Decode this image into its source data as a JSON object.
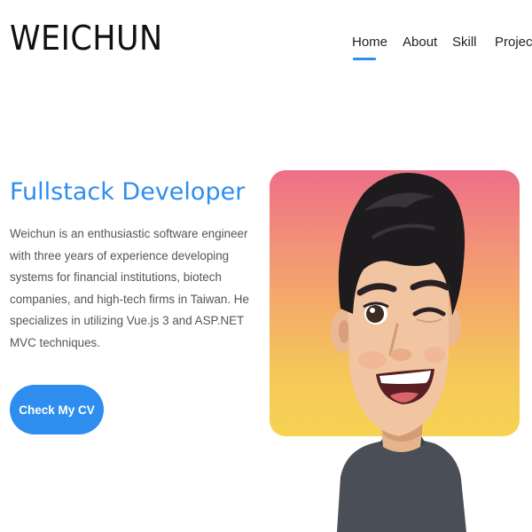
{
  "header": {
    "brand": "WEICHUN",
    "nav": [
      {
        "label": "Home",
        "active": true
      },
      {
        "label": "About",
        "active": false
      },
      {
        "label": "Skill",
        "active": false
      },
      {
        "label": "Projects",
        "active": false
      }
    ]
  },
  "hero": {
    "title": "Fullstack Developer",
    "description": "Weichun is an enthusiastic software engineer with three years of experience developing systems for financial institutions, biotech companies, and high-tech firms in Taiwan. He specializes in utilizing Vue.js 3 and ASP.NET MVC techniques.",
    "cta_label": "Check My CV"
  },
  "colors": {
    "accent": "#2d8ef0",
    "card_gradient_top": "#ee6f88",
    "card_gradient_bottom": "#f7d352"
  },
  "icons": {
    "avatar": "cartoon-avatar-winking-icon"
  }
}
